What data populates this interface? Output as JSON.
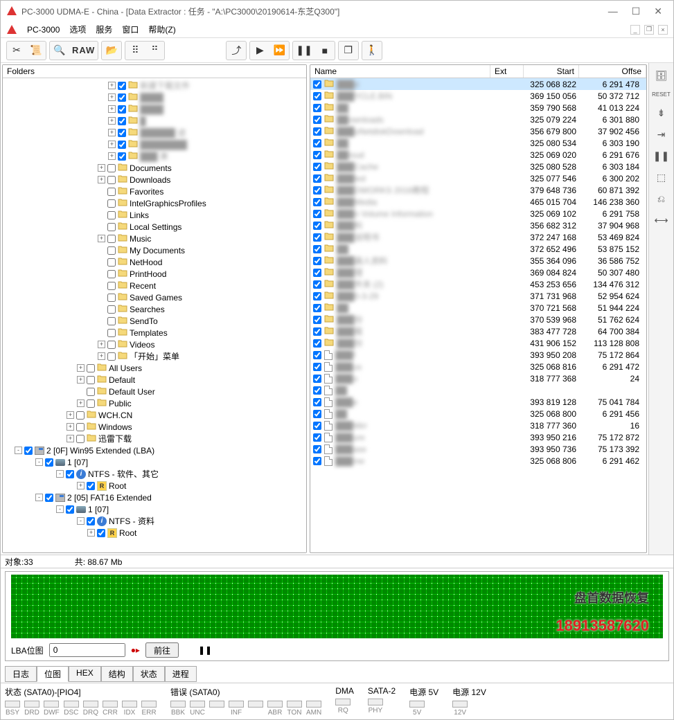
{
  "title": "PC-3000 UDMA-E - China - [Data Extractor : 任务 - \"A:\\PC3000\\20190614-东芝Q300\"]",
  "menubar": {
    "app": "PC-3000",
    "items": [
      "选项",
      "服务",
      "窗口",
      "帮助(Z)"
    ]
  },
  "toolbar": {
    "raw": "RAW"
  },
  "folders_label": "Folders",
  "tree": [
    {
      "indent": 150,
      "exp": "+",
      "chk": true,
      "icon": "folder",
      "label": "新建下载文件",
      "blur": true
    },
    {
      "indent": 150,
      "exp": "+",
      "chk": true,
      "icon": "folder",
      "label": "████",
      "blur": true
    },
    {
      "indent": 150,
      "exp": "+",
      "chk": true,
      "icon": "folder",
      "label": "████",
      "blur": true
    },
    {
      "indent": 150,
      "exp": "+",
      "chk": true,
      "icon": "folder",
      "label": "█",
      "blur": true
    },
    {
      "indent": 150,
      "exp": "+",
      "chk": true,
      "icon": "folder",
      "label": "██████ 迹",
      "blur": true
    },
    {
      "indent": 150,
      "exp": "+",
      "chk": true,
      "icon": "folder",
      "label": "████████",
      "blur": true
    },
    {
      "indent": 150,
      "exp": "+",
      "chk": true,
      "icon": "folder",
      "label": "███ 果",
      "blur": true
    },
    {
      "indent": 135,
      "exp": "+",
      "chk": false,
      "icon": "folder",
      "label": "Documents"
    },
    {
      "indent": 135,
      "exp": "+",
      "chk": false,
      "icon": "folder",
      "label": "Downloads"
    },
    {
      "indent": 135,
      "exp": "",
      "chk": false,
      "icon": "folder",
      "label": "Favorites"
    },
    {
      "indent": 135,
      "exp": "",
      "chk": false,
      "icon": "folder",
      "label": "IntelGraphicsProfiles"
    },
    {
      "indent": 135,
      "exp": "",
      "chk": false,
      "icon": "folder",
      "label": "Links"
    },
    {
      "indent": 135,
      "exp": "",
      "chk": false,
      "icon": "folder",
      "label": "Local Settings"
    },
    {
      "indent": 135,
      "exp": "+",
      "chk": false,
      "icon": "folder",
      "label": "Music"
    },
    {
      "indent": 135,
      "exp": "",
      "chk": false,
      "icon": "folder",
      "label": "My Documents"
    },
    {
      "indent": 135,
      "exp": "",
      "chk": false,
      "icon": "folder",
      "label": "NetHood"
    },
    {
      "indent": 135,
      "exp": "",
      "chk": false,
      "icon": "folder",
      "label": "PrintHood"
    },
    {
      "indent": 135,
      "exp": "",
      "chk": false,
      "icon": "folder",
      "label": "Recent"
    },
    {
      "indent": 135,
      "exp": "",
      "chk": false,
      "icon": "folder",
      "label": "Saved Games"
    },
    {
      "indent": 135,
      "exp": "",
      "chk": false,
      "icon": "folder",
      "label": "Searches"
    },
    {
      "indent": 135,
      "exp": "",
      "chk": false,
      "icon": "folder",
      "label": "SendTo"
    },
    {
      "indent": 135,
      "exp": "",
      "chk": false,
      "icon": "folder",
      "label": "Templates"
    },
    {
      "indent": 135,
      "exp": "+",
      "chk": false,
      "icon": "folder",
      "label": "Videos"
    },
    {
      "indent": 135,
      "exp": "+",
      "chk": false,
      "icon": "folder",
      "label": "「开始」菜单"
    },
    {
      "indent": 105,
      "exp": "+",
      "chk": false,
      "icon": "folder",
      "label": "All Users"
    },
    {
      "indent": 105,
      "exp": "+",
      "chk": false,
      "icon": "folder",
      "label": "Default"
    },
    {
      "indent": 105,
      "exp": "",
      "chk": false,
      "icon": "folder",
      "label": "Default User"
    },
    {
      "indent": 105,
      "exp": "+",
      "chk": false,
      "icon": "folder",
      "label": "Public"
    },
    {
      "indent": 90,
      "exp": "+",
      "chk": false,
      "icon": "folder",
      "label": "WCH.CN"
    },
    {
      "indent": 90,
      "exp": "+",
      "chk": false,
      "icon": "folder",
      "label": "Windows"
    },
    {
      "indent": 90,
      "exp": "+",
      "chk": false,
      "icon": "folder",
      "label": "迅雷下载"
    },
    {
      "indent": 15,
      "exp": "-",
      "chk": true,
      "icon": "drive",
      "label": "2 [0F] Win95 Extended  (LBA)"
    },
    {
      "indent": 45,
      "exp": "-",
      "chk": true,
      "icon": "disk",
      "label": "1 [07]"
    },
    {
      "indent": 75,
      "exp": "-",
      "chk": true,
      "icon": "info",
      "label": "NTFS - 软件、其它"
    },
    {
      "indent": 105,
      "exp": "+",
      "chk": true,
      "icon": "r",
      "label": "Root"
    },
    {
      "indent": 45,
      "exp": "-",
      "chk": true,
      "icon": "drive",
      "label": "2 [05] FAT16 Extended"
    },
    {
      "indent": 75,
      "exp": "-",
      "chk": true,
      "icon": "disk",
      "label": "1 [07]"
    },
    {
      "indent": 105,
      "exp": "-",
      "chk": true,
      "icon": "info",
      "label": "NTFS - 资料"
    },
    {
      "indent": 120,
      "exp": "+",
      "chk": true,
      "icon": "r",
      "label": "Root"
    }
  ],
  "list_headers": {
    "name": "Name",
    "ext": "Ext",
    "start": "Start",
    "offset": "Offse"
  },
  "list": [
    {
      "chk": true,
      "icon": "folder",
      "name": "███d",
      "blur": true,
      "start": "325 068 822",
      "offset": "6 291 478",
      "sel": true
    },
    {
      "chk": true,
      "icon": "folder",
      "name": "███YCLE.BIN",
      "blur": true,
      "start": "369 150 056",
      "offset": "50 372 712"
    },
    {
      "chk": true,
      "icon": "folder",
      "name": "██",
      "blur": true,
      "start": "359 790 568",
      "offset": "41 013 224"
    },
    {
      "chk": true,
      "icon": "folder",
      "name": "██ownloads",
      "blur": true,
      "start": "325 079 224",
      "offset": "6 301 880"
    },
    {
      "chk": true,
      "icon": "folder",
      "name": "███uNetdiskDownload",
      "blur": true,
      "start": "356 679 800",
      "offset": "37 902 456"
    },
    {
      "chk": true,
      "icon": "folder",
      "name": "██",
      "blur": true,
      "start": "325 080 534",
      "offset": "6 303 190"
    },
    {
      "chk": true,
      "icon": "folder",
      "name": "██loud",
      "blur": true,
      "start": "325 069 020",
      "offset": "6 291 676"
    },
    {
      "chk": true,
      "icon": "folder",
      "name": "███Cache",
      "blur": true,
      "start": "325 080 528",
      "offset": "6 303 184"
    },
    {
      "chk": true,
      "icon": "folder",
      "name": "███led",
      "blur": true,
      "start": "325 077 546",
      "offset": "6 300 202"
    },
    {
      "chk": true,
      "icon": "folder",
      "name": "███DWORKS 2016教程",
      "blur": true,
      "start": "379 648 736",
      "offset": "60 871 392"
    },
    {
      "chk": true,
      "icon": "folder",
      "name": "███Media",
      "blur": true,
      "start": "465 015 704",
      "offset": "146 238 360"
    },
    {
      "chk": true,
      "icon": "folder",
      "name": "███n Volume Information",
      "blur": true,
      "start": "325 069 102",
      "offset": "6 291 758"
    },
    {
      "chk": true,
      "icon": "folder",
      "name": "███料",
      "blur": true,
      "start": "356 682 312",
      "offset": "37 904 968"
    },
    {
      "chk": true,
      "icon": "folder",
      "name": "███说明书",
      "blur": true,
      "start": "372 247 168",
      "offset": "53 469 824"
    },
    {
      "chk": true,
      "icon": "folder",
      "name": "██",
      "blur": true,
      "start": "372 652 496",
      "offset": "53 875 152"
    },
    {
      "chk": true,
      "icon": "folder",
      "name": "███器人资料",
      "blur": true,
      "start": "355 364 096",
      "offset": "36 586 752"
    },
    {
      "chk": true,
      "icon": "folder",
      "name": "███理",
      "blur": true,
      "start": "369 084 824",
      "offset": "50 307 480"
    },
    {
      "chk": true,
      "icon": "folder",
      "name": "███件夹 (2)",
      "blur": true,
      "start": "453 253 656",
      "offset": "134 476 312"
    },
    {
      "chk": true,
      "icon": "folder",
      "name": "███0-3-29",
      "blur": true,
      "start": "371 731 968",
      "offset": "52 954 624"
    },
    {
      "chk": true,
      "icon": "folder",
      "name": "██",
      "blur": true,
      "start": "370 721 568",
      "offset": "51 944 224"
    },
    {
      "chk": true,
      "icon": "folder",
      "name": "███份",
      "blur": true,
      "start": "370 539 968",
      "offset": "51 762 624"
    },
    {
      "chk": true,
      "icon": "folder",
      "name": "███载",
      "blur": true,
      "start": "383 477 728",
      "offset": "64 700 384"
    },
    {
      "chk": true,
      "icon": "folder",
      "name": "███份",
      "blur": true,
      "start": "431 906 152",
      "offset": "113 128 808"
    },
    {
      "chk": true,
      "icon": "file",
      "name": "███f",
      "blur": true,
      "start": "393 950 208",
      "offset": "75 172 864"
    },
    {
      "chk": true,
      "icon": "file",
      "name": "███us",
      "blur": true,
      "start": "325 068 816",
      "offset": "6 291 472"
    },
    {
      "chk": true,
      "icon": "file",
      "name": "███o",
      "blur": true,
      "start": "318 777 368",
      "offset": "24"
    },
    {
      "chk": true,
      "icon": "file",
      "name": "██",
      "blur": true,
      "start": "",
      "offset": ""
    },
    {
      "chk": true,
      "icon": "file",
      "name": "███e",
      "blur": true,
      "start": "393 819 128",
      "offset": "75 041 784"
    },
    {
      "chk": true,
      "icon": "file",
      "name": "██",
      "blur": true,
      "start": "325 068 800",
      "offset": "6 291 456"
    },
    {
      "chk": true,
      "icon": "file",
      "name": "███Mirr",
      "blur": true,
      "start": "318 777 360",
      "offset": "16"
    },
    {
      "chk": true,
      "icon": "file",
      "name": "███ure",
      "blur": true,
      "start": "393 950 216",
      "offset": "75 172 872"
    },
    {
      "chk": true,
      "icon": "file",
      "name": "███ase",
      "blur": true,
      "start": "393 950 736",
      "offset": "75 173 392"
    },
    {
      "chk": true,
      "icon": "file",
      "name": "███me",
      "blur": true,
      "start": "325 068 806",
      "offset": "6 291 462"
    }
  ],
  "status1": {
    "objects": "对象:33",
    "total": "共:   88.67 Mb"
  },
  "bitmap": {
    "label": "LBA位图",
    "value": "0",
    "go": "前往",
    "wm1": "盘首数据恢复",
    "wm2": "18913587620"
  },
  "tabs": [
    "日志",
    "位图",
    "HEX",
    "结构",
    "状态",
    "进程"
  ],
  "active_tab": 1,
  "bottom": {
    "sata0": "状态 (SATA0)-[PIO4]",
    "err": "错误 (SATA0)",
    "dma": "DMA",
    "sata2": "SATA-2",
    "p5": "电源 5V",
    "p12": "电源 12V",
    "s": [
      "BSY",
      "DRD",
      "DWF",
      "DSC",
      "DRQ",
      "CRR",
      "IDX",
      "ERR"
    ],
    "e": [
      "BBK",
      "UNC",
      "",
      "INF",
      "",
      "ABR",
      "TON",
      "AMN"
    ],
    "d": [
      "RQ"
    ],
    "s2": [
      "PHY"
    ],
    "p5l": [
      "5V"
    ],
    "p12l": [
      "12V"
    ]
  }
}
